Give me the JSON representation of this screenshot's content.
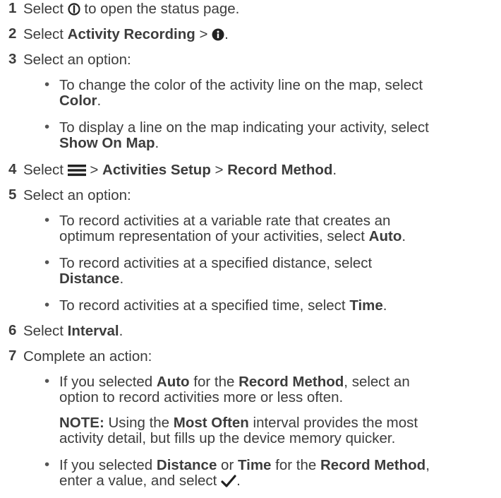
{
  "steps": [
    {
      "num": "1",
      "pre": "Select ",
      "post": " to open the status page.",
      "icon": "power-icon"
    },
    {
      "num": "2",
      "pre": "Select ",
      "b1": "Activity Recording",
      "post": " > ",
      "icon": "info-icon",
      "end": "."
    },
    {
      "num": "3",
      "text": "Select an option:"
    },
    {
      "num": "4",
      "pre": "Select ",
      "icon": "menu-icon",
      "mid": " > ",
      "b1": "Activities Setup",
      "mid2": " > ",
      "b2": "Record Method",
      "end": "."
    },
    {
      "num": "5",
      "text": "Select an option:"
    },
    {
      "num": "6",
      "pre": "Select ",
      "b1": "Interval",
      "end": "."
    },
    {
      "num": "7",
      "text": "Complete an action:"
    }
  ],
  "step3_bullets": [
    {
      "line1": "To change the color of the activity line on the map, select",
      "bold": "Color",
      "end": "."
    },
    {
      "line1": "To display a line on the map indicating your activity, select",
      "bold": "Show On Map",
      "end": "."
    }
  ],
  "step5_bullets": [
    {
      "line1": "To record activities at a variable rate that creates an",
      "line2pre": "optimum representation of your activities, select ",
      "bold": "Auto",
      "end": "."
    },
    {
      "line1": "To record activities at a specified distance, select",
      "bold": "Distance",
      "end": "."
    },
    {
      "line1pre": "To record activities at a specified time, select ",
      "bold": "Time",
      "end": "."
    }
  ],
  "step7_bullets": [
    {
      "pre": "If you selected ",
      "b1": "Auto",
      "mid": " for the ",
      "b2": "Record Method",
      "post": ", select an",
      "line2": "option to record activities more or less often."
    },
    {
      "pre": "If you selected ",
      "b1": "Distance",
      "mid": " or ",
      "b2": "Time",
      "mid2": " for the ",
      "b3": "Record Method",
      "post": ",",
      "line2pre": "enter a value, and select ",
      "icon": "check-icon",
      "end": "."
    }
  ],
  "note": {
    "label": "NOTE:",
    "pre": " Using the ",
    "bold": "Most Often",
    "post": " interval provides the most",
    "line2": "activity detail, but fills up the device memory quicker."
  },
  "bullet_char": "•"
}
